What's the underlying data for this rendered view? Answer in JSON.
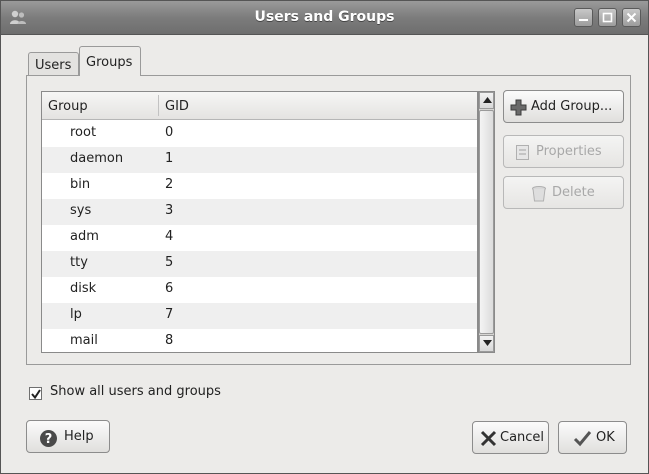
{
  "window": {
    "title": "Users and Groups",
    "controls": [
      "minimize-icon",
      "maximize-icon",
      "close-icon"
    ]
  },
  "tabs": [
    {
      "label": "Users",
      "selected": false
    },
    {
      "label": "Groups",
      "selected": true
    }
  ],
  "table": {
    "headers": [
      "Group",
      "GID"
    ],
    "rows": [
      {
        "group": "root",
        "gid": "0"
      },
      {
        "group": "daemon",
        "gid": "1"
      },
      {
        "group": "bin",
        "gid": "2"
      },
      {
        "group": "sys",
        "gid": "3"
      },
      {
        "group": "adm",
        "gid": "4"
      },
      {
        "group": "tty",
        "gid": "5"
      },
      {
        "group": "disk",
        "gid": "6"
      },
      {
        "group": "lp",
        "gid": "7"
      },
      {
        "group": "mail",
        "gid": "8"
      }
    ]
  },
  "side_buttons": {
    "add_group": {
      "label": "Add Group...",
      "icon": "plus-icon",
      "enabled": true
    },
    "properties": {
      "label": "Properties",
      "icon": "properties-icon",
      "enabled": false
    },
    "delete": {
      "label": "Delete",
      "icon": "trash-icon",
      "enabled": false
    }
  },
  "show_all": {
    "label": "Show all users and groups",
    "checked": true
  },
  "footer": {
    "help": {
      "label": "Help",
      "icon": "help-icon"
    },
    "cancel": {
      "label": "Cancel",
      "icon": "cancel-icon"
    },
    "ok": {
      "label": "OK",
      "icon": "ok-icon"
    }
  }
}
